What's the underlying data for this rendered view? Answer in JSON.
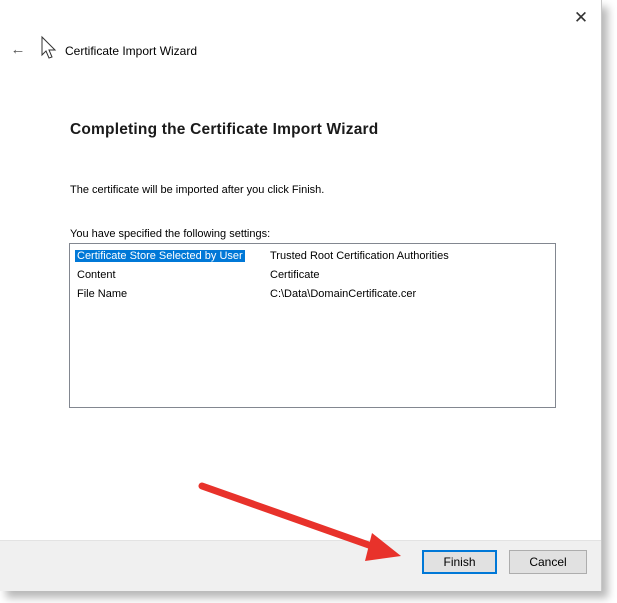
{
  "window": {
    "title": "Certificate Import Wizard",
    "close_glyph": "✕",
    "back_glyph": "←"
  },
  "content": {
    "heading": "Completing the Certificate Import Wizard",
    "intro": "The certificate will be imported after you click Finish.",
    "settings_label": "You have specified the following settings:",
    "settings": [
      {
        "key": "Certificate Store Selected by User",
        "value": "Trusted Root Certification Authorities",
        "selected": true
      },
      {
        "key": "Content",
        "value": "Certificate",
        "selected": false
      },
      {
        "key": "File Name",
        "value": "C:\\Data\\DomainCertificate.cer",
        "selected": false
      }
    ]
  },
  "buttons": {
    "finish": "Finish",
    "cancel": "Cancel"
  },
  "colors": {
    "selection": "#0078d7",
    "annotation_arrow": "#e8322b"
  },
  "icons": {
    "wizard": "certificate-wizard-icon",
    "close": "close-icon",
    "back": "back-arrow-icon"
  }
}
